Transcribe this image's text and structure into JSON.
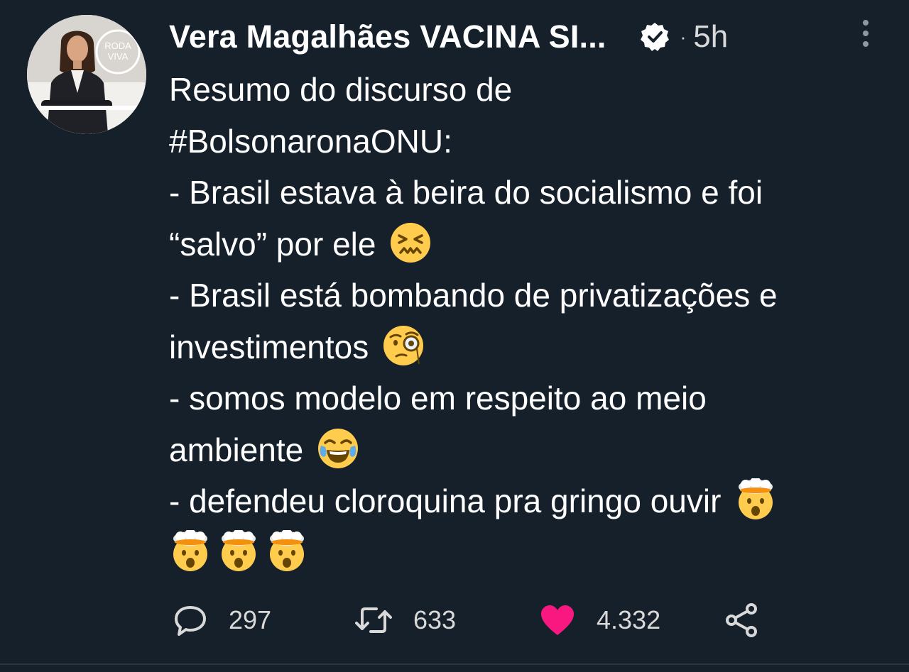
{
  "author": {
    "display_name": "Vera Magalhães VACINA SI...",
    "avatar_badge_text": "RODA VIVA",
    "verified": true,
    "time_separator": "·",
    "timestamp": "5h"
  },
  "tweet": {
    "line1": "Resumo do discurso de",
    "hashtag": "#BolsonaronaONU",
    "hashtag_suffix": ":",
    "line3": "- Brasil estava à beira do socialismo e foi",
    "line4": "“salvo” por ele",
    "line5": "- Brasil está bombando de privatizações e",
    "line6": "investimentos",
    "line7": "- somos modelo em respeito ao meio",
    "line8": "ambiente",
    "line9": "- defendeu cloroquina pra gringo ouvir",
    "emojis": {
      "line4": "confounded-face",
      "line6": "face-with-monocle",
      "line8": "face-with-tears-of-joy",
      "line9": "exploding-head",
      "line10": [
        "exploding-head",
        "exploding-head",
        "exploding-head"
      ]
    }
  },
  "actions": {
    "replies": "297",
    "retweets": "633",
    "likes": "4.332",
    "icons": [
      "reply-icon",
      "retweet-icon",
      "like-icon",
      "share-icon"
    ],
    "like_color": "#f91880"
  },
  "colors": {
    "background": "#15202b",
    "text": "#ffffff",
    "muted": "#d9d9d9"
  }
}
